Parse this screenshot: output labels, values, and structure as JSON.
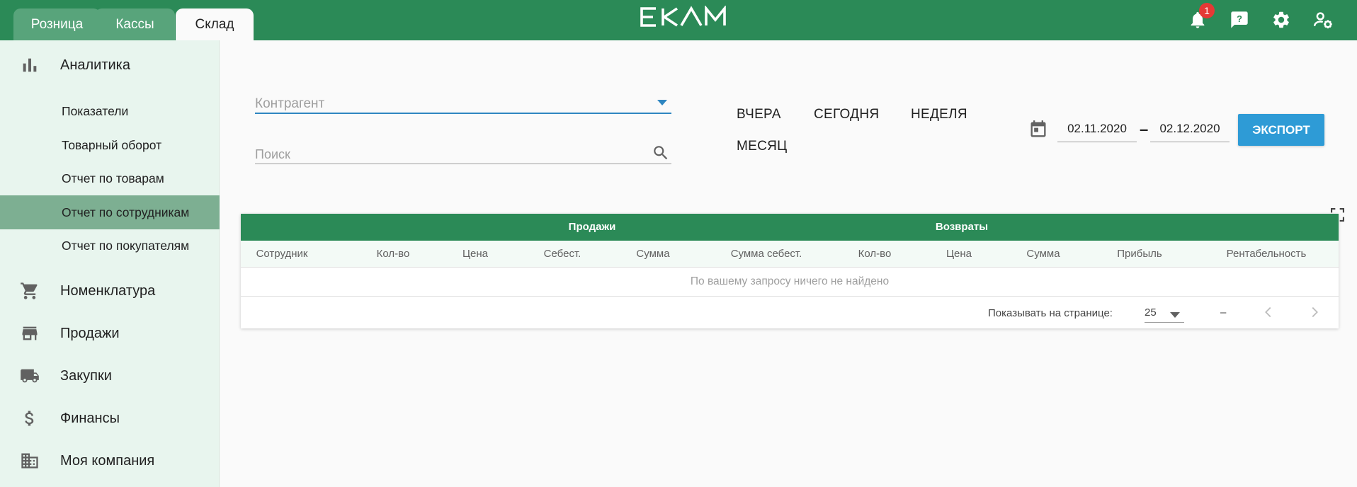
{
  "header": {
    "tabs": [
      {
        "label": "Розница"
      },
      {
        "label": "Кассы"
      },
      {
        "label": "Склад"
      }
    ],
    "logo_text": "EKAM",
    "notification_count": "1",
    "brand_color": "#2b8a57"
  },
  "sidebar": {
    "analytics": "Аналитика",
    "sub_items": [
      {
        "label": "Показатели"
      },
      {
        "label": "Товарный оборот"
      },
      {
        "label": "Отчет по товарам"
      },
      {
        "label": "Отчет по сотрудникам"
      },
      {
        "label": "Отчет по покупателям"
      }
    ],
    "items": [
      {
        "label": "Номенклатура",
        "icon": "cart-icon"
      },
      {
        "label": "Продажи",
        "icon": "store-icon"
      },
      {
        "label": "Закупки",
        "icon": "truck-icon"
      },
      {
        "label": "Финансы",
        "icon": "dollar-icon"
      },
      {
        "label": "Моя компания",
        "icon": "building-icon"
      }
    ]
  },
  "filters": {
    "counterparty_placeholder": "Контрагент",
    "search_placeholder": "Поиск",
    "periods": {
      "yesterday": "ВЧЕРА",
      "today": "СЕГОДНЯ",
      "week": "НЕДЕЛЯ",
      "month": "МЕСЯЦ"
    },
    "date_from": "02.11.2020",
    "date_separator": "–",
    "date_to": "02.12.2020",
    "export_label": "ЭКСПОРТ"
  },
  "table": {
    "groups": {
      "sales": "Продажи",
      "returns": "Возвраты"
    },
    "columns": [
      "Сотрудник",
      "Кол-во",
      "Цена",
      "Себест.",
      "Сумма",
      "Сумма себест.",
      "Кол-во",
      "Цена",
      "Сумма",
      "Прибыль",
      "Рентабельность"
    ],
    "empty_message": "По вашему запросу ничего не найдено",
    "pagination": {
      "rows_per_page_label": "Показывать на странице:",
      "rows_per_page_value": "25",
      "range": "–"
    }
  }
}
